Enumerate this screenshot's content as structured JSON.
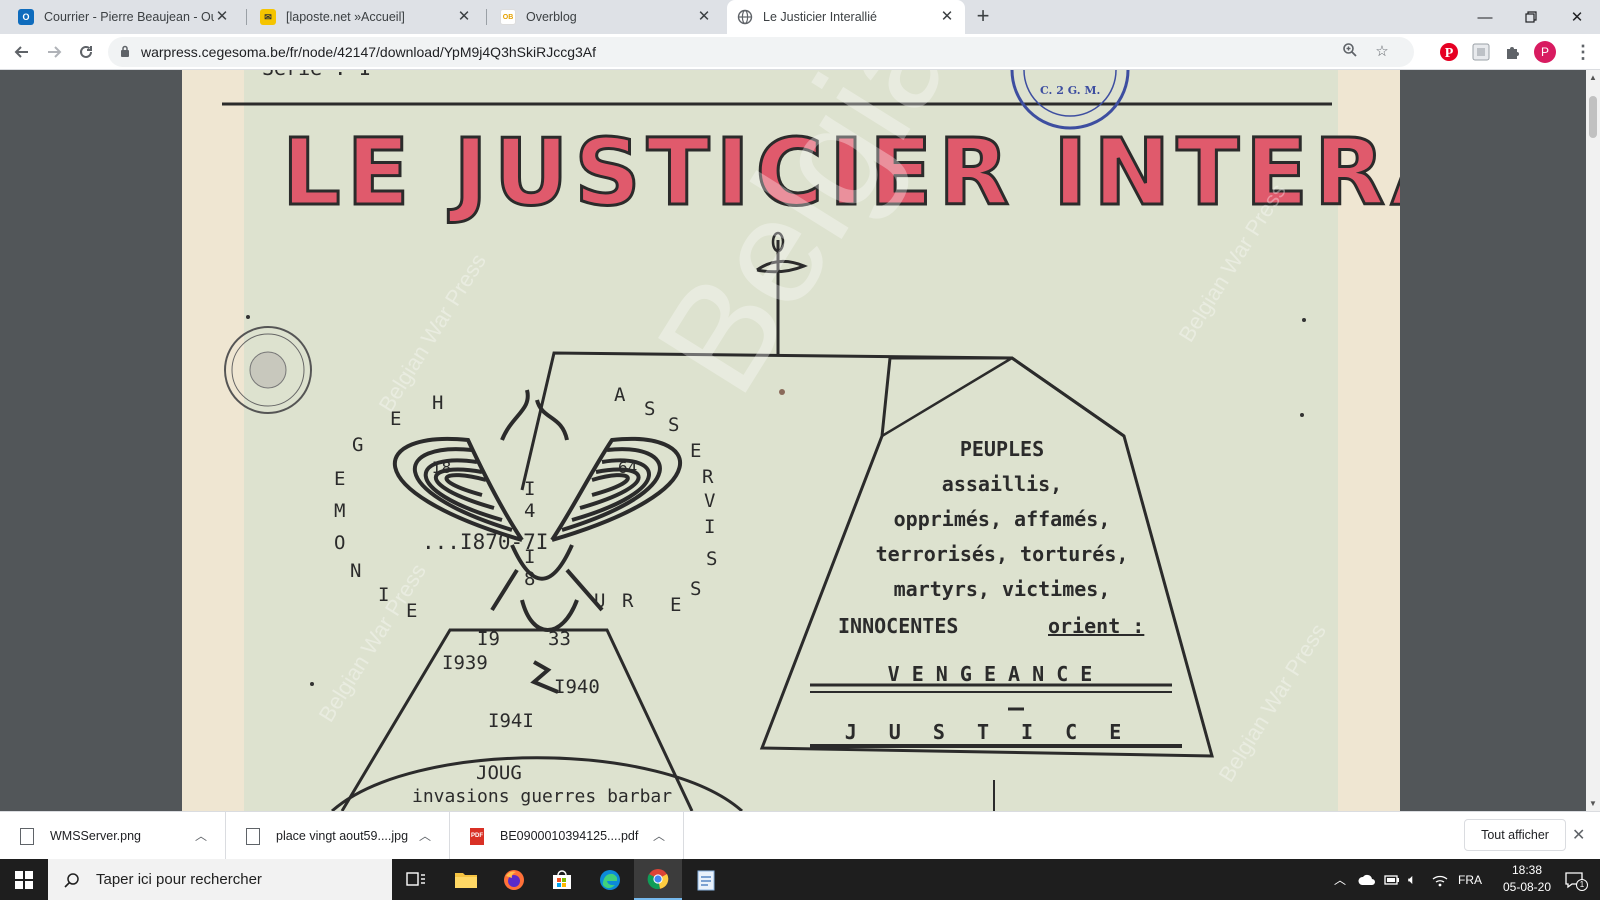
{
  "browser": {
    "tabs": [
      {
        "title": "Courrier - Pierre Beaujean - Outlo",
        "favicon": "outlook-icon",
        "active": false
      },
      {
        "title": "[laposte.net »Accueil]",
        "favicon": "laposte-mail-icon",
        "active": false
      },
      {
        "title": "Overblog",
        "favicon": "overblog-icon",
        "active": false
      },
      {
        "title": "Le Justicier Interallié",
        "favicon": "globe-icon",
        "active": true
      }
    ],
    "url": "warpress.cegesoma.be/fr/node/42147/download/YpM9j4Q3hSkiRJccg3Af",
    "profile_initial": "P"
  },
  "document": {
    "header_fragment": "Serie : 1",
    "stamp_text": "C. 2 G. M.",
    "masthead": "LE JUSTICIER INTERALLIE",
    "eagle": {
      "left_arc_letters": [
        "E",
        "M",
        "O",
        "N",
        "I",
        "E",
        "G",
        "E",
        "H"
      ],
      "right_arc_letters": [
        "A",
        "S",
        "S",
        "E",
        "R",
        "V",
        "I",
        "S",
        "S",
        "E",
        "R",
        "U"
      ],
      "center_vertical": [
        "I",
        "4",
        "I",
        "8"
      ],
      "center_text": "...I870-7I",
      "wing_left_year": "I8",
      "wing_right_year": "64"
    },
    "triangle_years": [
      "I9",
      "33",
      "I939",
      "I940",
      "I94I"
    ],
    "joug": "JOUG",
    "joug_sub": "invasions guerres barbar",
    "house_lines": [
      "PEUPLES",
      "assaillis,",
      "opprimés, affamés,",
      "terrorisés, torturés,",
      "martyrs, victimes,",
      "INNOCENTES",
      "orient :"
    ],
    "vengeance": "V E N G E A N C E",
    "justice": "J U S T I C E",
    "watermark": "Belgian War Press"
  },
  "downloads": {
    "items": [
      {
        "name": "WMSServer.png",
        "type": "file"
      },
      {
        "name": "place vingt aout59....jpg",
        "type": "file"
      },
      {
        "name": "BE0900010394125....pdf",
        "type": "pdf",
        "badge": "PDF"
      }
    ],
    "show_all": "Tout afficher"
  },
  "taskbar": {
    "search_placeholder": "Taper ici pour rechercher",
    "language": "FRA",
    "time": "18:38",
    "date": "05-08-20",
    "notification_count": "1"
  },
  "colors": {
    "masthead_red": "#e05a6c",
    "ink": "#2b2b2b",
    "paper": "#dde2cf",
    "stamp_blue": "#3d4ea0"
  }
}
